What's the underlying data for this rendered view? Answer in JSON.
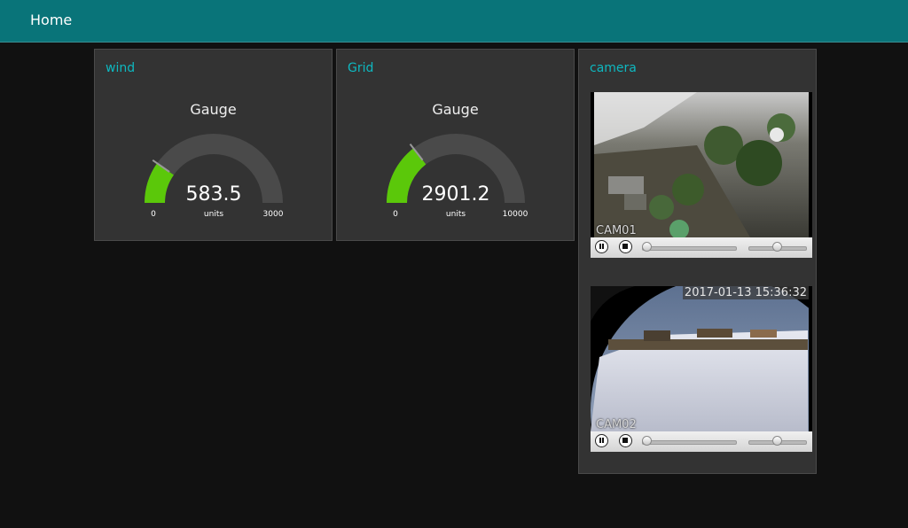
{
  "header": {
    "title": "Home"
  },
  "widgets": {
    "wind": {
      "title": "wind",
      "gauge_label": "Gauge",
      "value": 583.5,
      "value_text": "583.5",
      "min": 0,
      "max": 3000,
      "min_text": "0",
      "max_text": "3000",
      "units": "units",
      "fill_color": "#5bc80a",
      "track_color": "#4a4a4a"
    },
    "grid": {
      "title": "Grid",
      "gauge_label": "Gauge",
      "value": 2901.2,
      "value_text": "2901.2",
      "min": 0,
      "max": 10000,
      "min_text": "0",
      "max_text": "10000",
      "units": "units",
      "fill_color": "#5bc80a",
      "track_color": "#4a4a4a"
    },
    "camera": {
      "title": "camera",
      "cameras": [
        {
          "name": "CAM01",
          "timestamp": ""
        },
        {
          "name": "CAM02",
          "timestamp": "2017-01-13 15:36:32"
        }
      ]
    }
  },
  "colors": {
    "header_bg": "#097479",
    "card_title": "#0eb8c0",
    "background": "#111111",
    "card_bg": "#333333"
  }
}
